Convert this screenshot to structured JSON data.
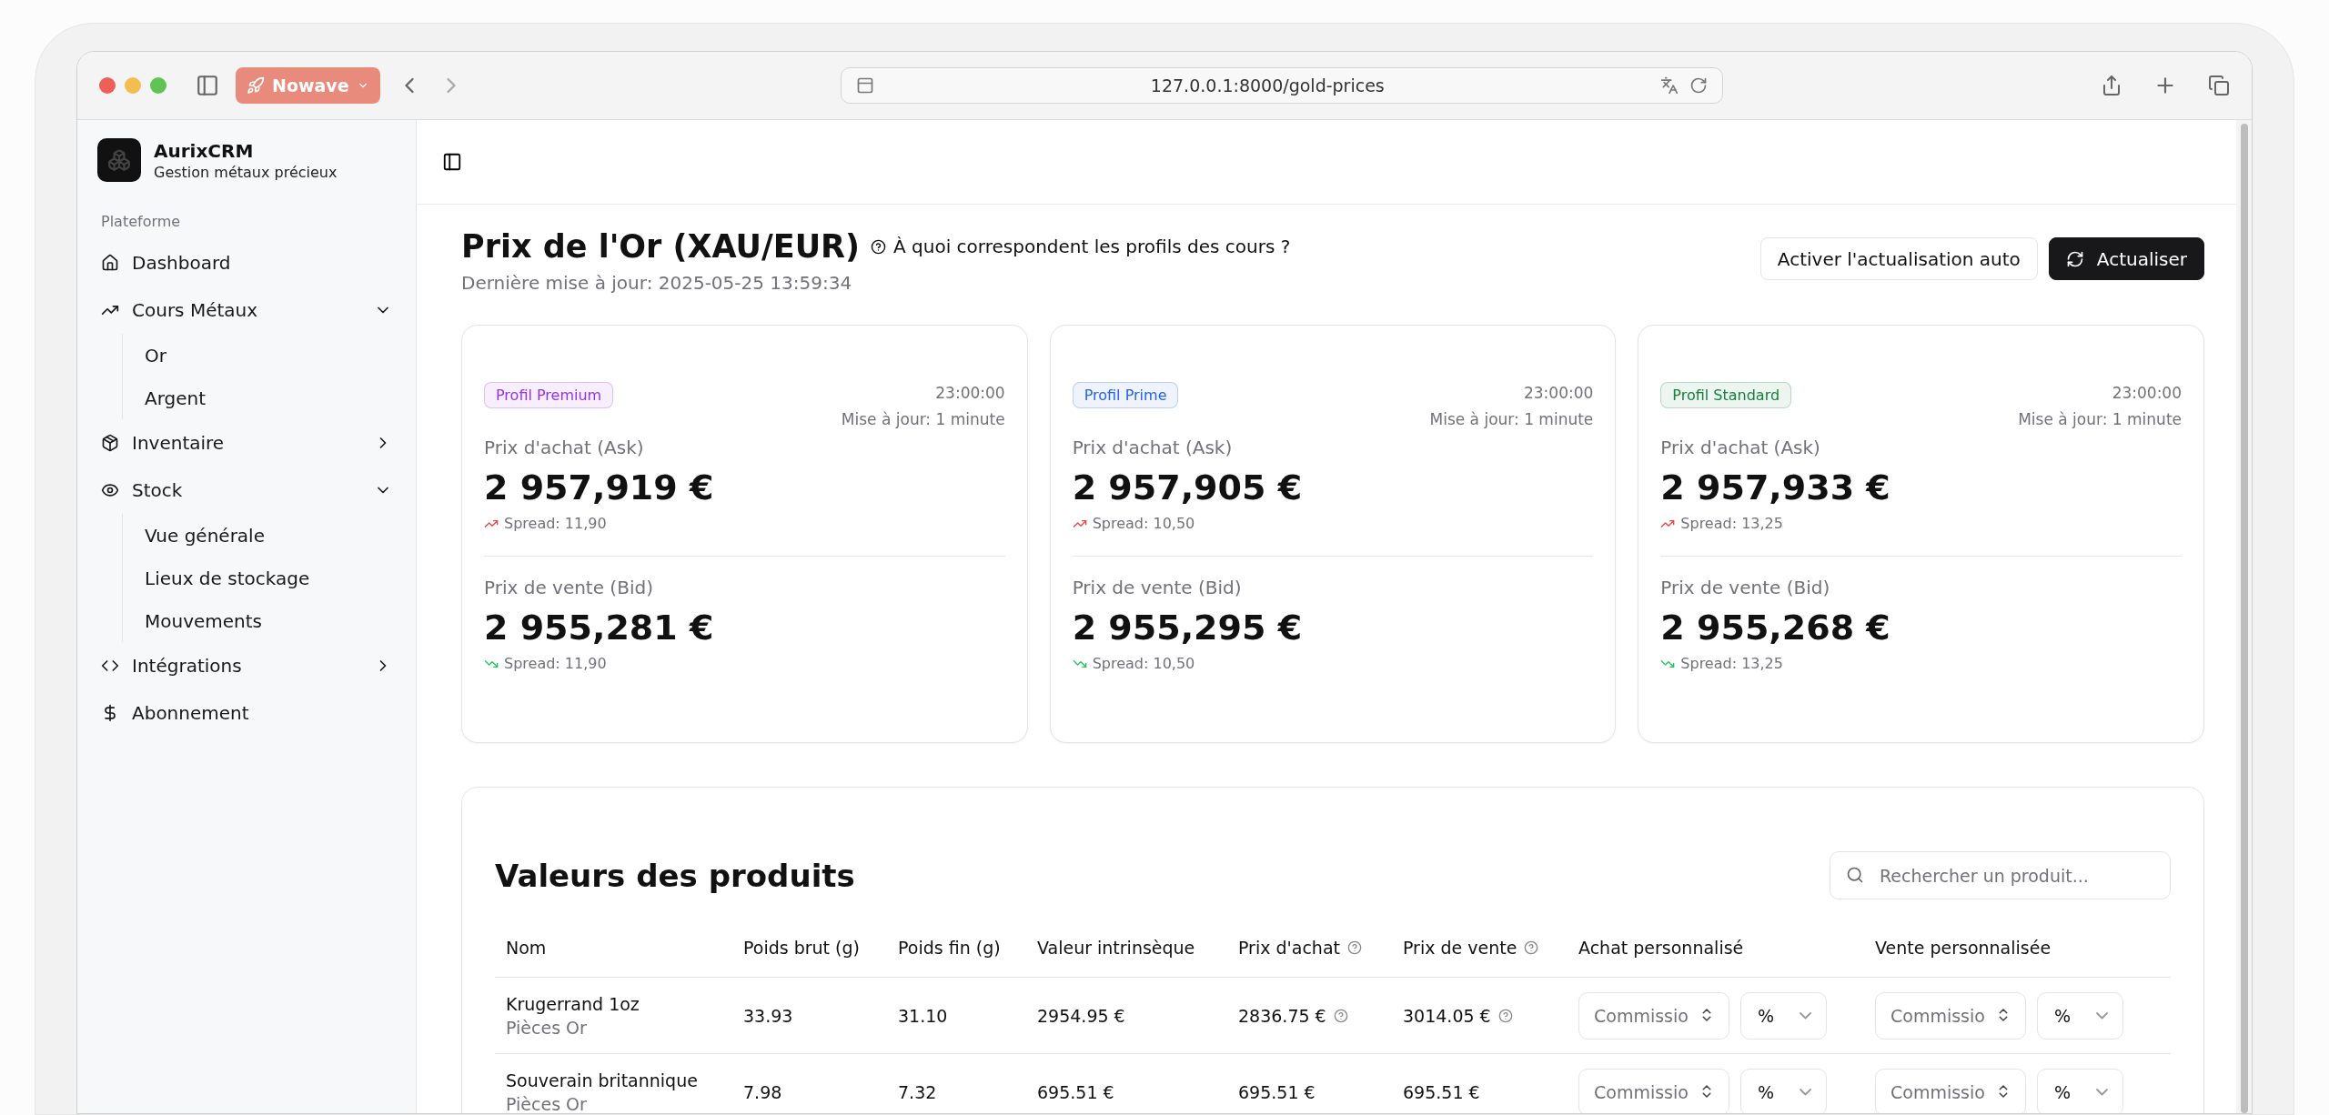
{
  "browser": {
    "site_button": "Nowave",
    "url": "127.0.0.1:8000/gold-prices"
  },
  "sidebar": {
    "brand": {
      "name": "AurixCRM",
      "subtitle": "Gestion métaux précieux"
    },
    "section_label": "Plateforme",
    "items": [
      {
        "label": "Dashboard",
        "kind": "link"
      },
      {
        "label": "Cours Métaux",
        "kind": "group",
        "expanded": true,
        "children": [
          {
            "label": "Or"
          },
          {
            "label": "Argent"
          }
        ]
      },
      {
        "label": "Inventaire",
        "kind": "group",
        "expanded": false
      },
      {
        "label": "Stock",
        "kind": "group",
        "expanded": true,
        "children": [
          {
            "label": "Vue générale"
          },
          {
            "label": "Lieux de stockage"
          },
          {
            "label": "Mouvements"
          }
        ]
      },
      {
        "label": "Intégrations",
        "kind": "group",
        "expanded": false
      },
      {
        "label": "Abonnement",
        "kind": "link"
      }
    ]
  },
  "header": {
    "title": "Prix de l'Or (XAU/EUR)",
    "help_link": "À quoi correspondent les profils des cours ?",
    "last_update": "Dernière mise à jour: 2025-05-25 13:59:34",
    "buttons": [
      {
        "label": "Activer l'actualisation auto",
        "kind": "outline"
      },
      {
        "label": "Actualiser",
        "kind": "primary"
      }
    ]
  },
  "price_cards": [
    {
      "badge": "Profil Premium",
      "color": "#9333ea",
      "time": "23:00:00",
      "update_note": "Mise à jour: 1 minute",
      "ask": {
        "label": "Prix d'achat (Ask)",
        "value": "2 957,919 €",
        "spread": "Spread: 11,90"
      },
      "bid": {
        "label": "Prix de vente (Bid)",
        "value": "2 955,281 €",
        "spread": "Spread: 11,90"
      }
    },
    {
      "badge": "Profil Prime",
      "color": "#2563eb",
      "time": "23:00:00",
      "update_note": "Mise à jour: 1 minute",
      "ask": {
        "label": "Prix d'achat (Ask)",
        "value": "2 957,905 €",
        "spread": "Spread: 10,50"
      },
      "bid": {
        "label": "Prix de vente (Bid)",
        "value": "2 955,295 €",
        "spread": "Spread: 10,50"
      }
    },
    {
      "badge": "Profil Standard",
      "color": "#15803d",
      "time": "23:00:00",
      "update_note": "Mise à jour: 1 minute",
      "ask": {
        "label": "Prix d'achat (Ask)",
        "value": "2 957,933 €",
        "spread": "Spread: 13,25"
      },
      "bid": {
        "label": "Prix de vente (Bid)",
        "value": "2 955,268 €",
        "spread": "Spread: 13,25"
      }
    }
  ],
  "products": {
    "title": "Valeurs des produits",
    "search": {
      "placeholder": "Rechercher un produit..."
    },
    "columns": [
      {
        "label": "Nom",
        "help": false
      },
      {
        "label": "Poids brut (g)",
        "help": false
      },
      {
        "label": "Poids fin (g)",
        "help": false
      },
      {
        "label": "Valeur intrinsèque",
        "help": false
      },
      {
        "label": "Prix d'achat",
        "help": true
      },
      {
        "label": "Prix de vente",
        "help": true
      },
      {
        "label": "Achat personnalisé",
        "help": false
      },
      {
        "label": "Vente personnalisée",
        "help": false
      }
    ],
    "rows": [
      {
        "name": "Krugerrand 1oz",
        "category": "Pièces Or",
        "gross": "33.93",
        "fine": "31.10",
        "intrinsic": "2954.95 €",
        "buy": "2836.75 €",
        "buy_help": true,
        "sell": "3014.05 €",
        "sell_help": true,
        "custom_buy": {
          "placeholder": "Commissio",
          "unit": "%"
        },
        "custom_sell": {
          "placeholder": "Commissio",
          "unit": "%"
        }
      },
      {
        "name": "Souverain britannique",
        "category": "Pièces Or",
        "gross": "7.98",
        "fine": "7.32",
        "intrinsic": "695.51 €",
        "buy": "695.51 €",
        "buy_help": false,
        "sell": "695.51 €",
        "sell_help": false,
        "custom_buy": {
          "placeholder": "Commissio",
          "unit": "%"
        },
        "custom_sell": {
          "placeholder": "Commissio",
          "unit": "%"
        }
      }
    ]
  }
}
